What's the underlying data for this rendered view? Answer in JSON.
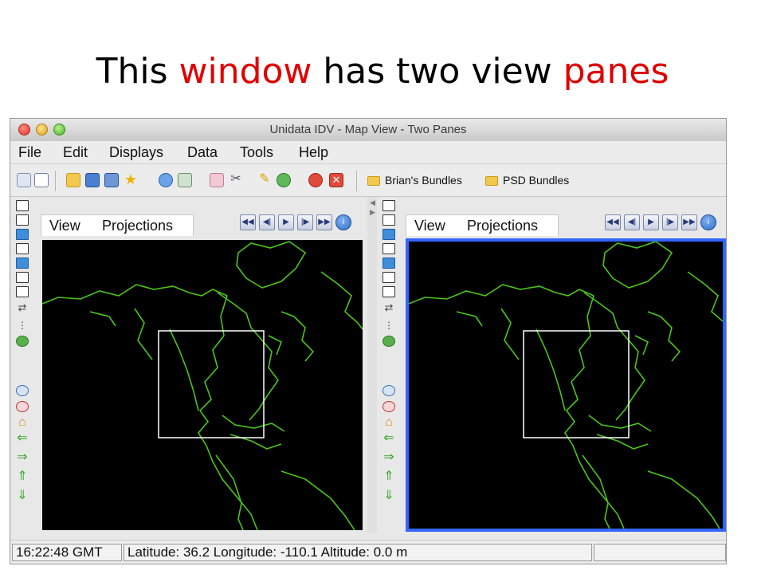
{
  "slide_title": {
    "part1": "This ",
    "part2": "window",
    "part3": " has two view ",
    "part4": "panes"
  },
  "colors": {
    "title_accent": "#e00000",
    "map_background": "#000000",
    "coastline": "#4cc417",
    "active_pane_border": "#3366ff"
  },
  "window": {
    "title": "Unidata IDV - Map View - Two Panes",
    "menu": [
      "File",
      "Edit",
      "Displays",
      "Data",
      "Tools",
      "Help"
    ],
    "toolbar": {
      "bundles": [
        "Brian's Bundles",
        "PSD Bundles"
      ]
    },
    "panes": [
      {
        "tab_view": "View",
        "tab_projections": "Projections",
        "active": false
      },
      {
        "tab_view": "View",
        "tab_projections": "Projections",
        "active": true
      }
    ],
    "status": {
      "time": "16:22:48 GMT",
      "location": "Latitude:  36.2   Longitude: -110.1   Altitude: 0.0 m"
    }
  }
}
